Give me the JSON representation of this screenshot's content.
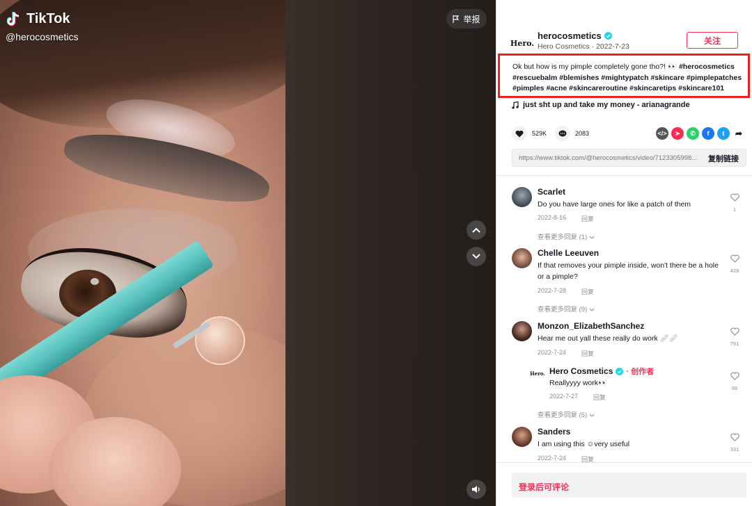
{
  "video": {
    "brand": "TikTok",
    "handle": "@herocosmetics",
    "report_label": "举报"
  },
  "author": {
    "avatar_text": "Hero.",
    "username": "herocosmetics",
    "subtitle": "Hero Cosmetics · 2022-7-23",
    "follow_label": "关注"
  },
  "caption": {
    "text": "Ok but how is my pimple completely gone tho?! 👀",
    "hashtags": [
      "#herocosmetics",
      "#rescuebalm",
      "#blemishes",
      "#mightypatch",
      "#skincare",
      "#pimplepatches",
      "#pimples",
      "#acne",
      "#skincareroutine",
      "#skincaretips",
      "#skincare101"
    ]
  },
  "music": "just sht up and take my money - arianagrande",
  "stats": {
    "likes": "529K",
    "comments": "2083"
  },
  "share_icons": [
    "embed-icon",
    "send-icon",
    "whatsapp-icon",
    "facebook-icon",
    "twitter-icon",
    "share-arrow-icon"
  ],
  "link": {
    "url": "https://www.tiktok.com/@herocosmetics/video/7123305998...",
    "copy_label": "复制链接"
  },
  "comments": [
    {
      "name": "Scarlet",
      "text": "Do you have large ones for like a patch of them",
      "date": "2022-8-16",
      "reply": "回复",
      "likes": "1",
      "more": "查看更多回复 (1)"
    },
    {
      "name": "Chelle Leeuven",
      "text": "If that removes your pimple inside, won't there be a hole or a pimple?",
      "date": "2022-7-28",
      "reply": "回复",
      "likes": "428",
      "more": "查看更多回复 (9)"
    },
    {
      "name": "Monzon_ElizabethSanchez",
      "text": "Hear me out yall these really do work 🩹🩹",
      "date": "2022-7-24",
      "reply": "回复",
      "likes": "791"
    },
    {
      "name": "Hero Cosmetics",
      "creator_tag": "· 创作者",
      "text": "Reallyyyy work👀",
      "date": "2022-7-27",
      "reply": "回复",
      "likes": "66",
      "more": "查看更多回复 (5)"
    },
    {
      "name": "Sanders",
      "text": "I am using this ☺very useful",
      "date": "2022-7-24",
      "reply": "回复",
      "likes": "331"
    }
  ],
  "login_prompt": "登录后可评论",
  "colors": {
    "accent": "#fe2c55",
    "highlight_box": "#e8231e",
    "verified": "#20d5ec"
  }
}
